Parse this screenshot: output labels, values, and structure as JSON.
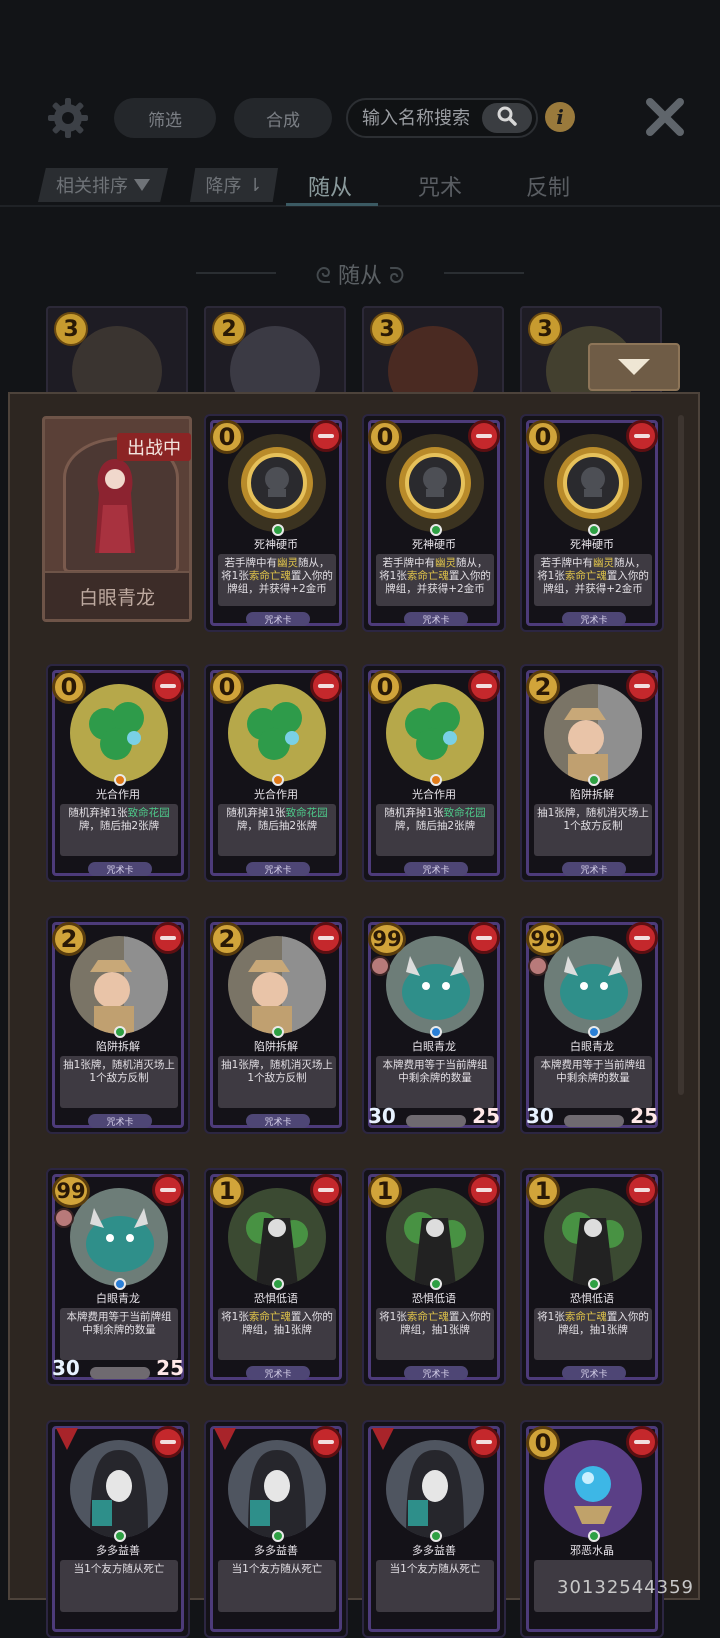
{
  "topbar": {
    "filter_label": "筛选",
    "craft_label": "合成",
    "search_placeholder": "输入名称搜索"
  },
  "sortbar": {
    "relevance_label": "相关排序",
    "order_label": "降序",
    "tabs": [
      "随从",
      "咒术",
      "反制"
    ],
    "active_tab": "随从"
  },
  "section": {
    "title": "随从"
  },
  "mini_cards": [
    {
      "cost": "3"
    },
    {
      "cost": "2"
    },
    {
      "cost": "3"
    },
    {
      "cost": "3"
    }
  ],
  "hero": {
    "badge": "出战中",
    "name": "白眼青龙"
  },
  "cards": [
    {
      "cost": "0",
      "name": "死神硬币",
      "desc": [
        "若手牌中有",
        "幽灵",
        "随从，将1张",
        "索命亡魂",
        "置入你的牌组，并获得+2金币"
      ],
      "type": "咒术卡",
      "gem": "#2ea043",
      "art": "coin"
    },
    {
      "cost": "0",
      "name": "死神硬币",
      "desc": [
        "若手牌中有",
        "幽灵",
        "随从，将1张",
        "索命亡魂",
        "置入你的牌组，并获得+2金币"
      ],
      "type": "咒术卡",
      "gem": "#2ea043",
      "art": "coin"
    },
    {
      "cost": "0",
      "name": "死神硬币",
      "desc": [
        "若手牌中有",
        "幽灵",
        "随从，将1张",
        "索命亡魂",
        "置入你的牌组，并获得+2金币"
      ],
      "type": "咒术卡",
      "gem": "#2ea043",
      "art": "coin"
    },
    {
      "cost": "0",
      "name": "光合作用",
      "desc": [
        "随机弃掉1张",
        "",
        "",
        "致命花园",
        "牌，随后抽2张牌"
      ],
      "type": "咒术卡",
      "gem": "#e07b1a",
      "art": "clover"
    },
    {
      "cost": "0",
      "name": "光合作用",
      "desc": [
        "随机弃掉1张",
        "",
        "",
        "致命花园",
        "牌，随后抽2张牌"
      ],
      "type": "咒术卡",
      "gem": "#e07b1a",
      "art": "clover"
    },
    {
      "cost": "0",
      "name": "光合作用",
      "desc": [
        "随机弃掉1张",
        "",
        "",
        "致命花园",
        "牌，随后抽2张牌"
      ],
      "type": "咒术卡",
      "gem": "#e07b1a",
      "art": "clover"
    },
    {
      "cost": "2",
      "name": "陷阱拆解",
      "desc": [
        "抽1张牌，随机消灭场上1个敌方反制",
        "",
        "",
        "",
        ""
      ],
      "type": "咒术卡",
      "gem": "#2ea043",
      "art": "detective"
    },
    {
      "cost": "2",
      "name": "陷阱拆解",
      "desc": [
        "抽1张牌，随机消灭场上1个敌方反制",
        "",
        "",
        "",
        ""
      ],
      "type": "咒术卡",
      "gem": "#2ea043",
      "art": "detective"
    },
    {
      "cost": "2",
      "name": "陷阱拆解",
      "desc": [
        "抽1张牌，随机消灭场上1个敌方反制",
        "",
        "",
        "",
        ""
      ],
      "type": "咒术卡",
      "gem": "#2ea043",
      "art": "detective"
    },
    {
      "cost": "99",
      "name": "白眼青龙",
      "desc": [
        "本牌费用等于当前牌组中剩余牌的数量",
        "",
        "",
        "",
        ""
      ],
      "atk": "30",
      "hp": "25",
      "gem": "#2a7fd6",
      "art": "dragon"
    },
    {
      "cost": "99",
      "name": "白眼青龙",
      "desc": [
        "本牌费用等于当前牌组中剩余牌的数量",
        "",
        "",
        "",
        ""
      ],
      "atk": "30",
      "hp": "25",
      "gem": "#2a7fd6",
      "art": "dragon"
    },
    {
      "cost": "99",
      "name": "白眼青龙",
      "desc": [
        "本牌费用等于当前牌组中剩余牌的数量",
        "",
        "",
        "",
        ""
      ],
      "atk": "30",
      "hp": "25",
      "gem": "#2a7fd6",
      "art": "dragon"
    },
    {
      "cost": "1",
      "name": "恐惧低语",
      "desc": [
        "将1张",
        "",
        "",
        "索命亡魂",
        "置入你的牌组，抽1张牌"
      ],
      "type": "咒术卡",
      "gem": "#2ea043",
      "art": "skeleton"
    },
    {
      "cost": "1",
      "name": "恐惧低语",
      "desc": [
        "将1张",
        "",
        "",
        "索命亡魂",
        "置入你的牌组，抽1张牌"
      ],
      "type": "咒术卡",
      "gem": "#2ea043",
      "art": "skeleton"
    },
    {
      "cost": "1",
      "name": "恐惧低语",
      "desc": [
        "将1张",
        "",
        "",
        "索命亡魂",
        "置入你的牌组，抽1张牌"
      ],
      "type": "咒术卡",
      "gem": "#2ea043",
      "art": "skeleton"
    },
    {
      "cost": "",
      "name": "多多益善",
      "desc": [
        "当1个友方随从死亡",
        "",
        "",
        "",
        ""
      ],
      "type": "",
      "gem": "#2ea043",
      "art": "hooded"
    },
    {
      "cost": "",
      "name": "多多益善",
      "desc": [
        "当1个友方随从死亡",
        "",
        "",
        "",
        ""
      ],
      "type": "",
      "gem": "#2ea043",
      "art": "hooded"
    },
    {
      "cost": "",
      "name": "多多益善",
      "desc": [
        "当1个友方随从死亡",
        "",
        "",
        "",
        ""
      ],
      "type": "",
      "gem": "#2ea043",
      "art": "hooded"
    },
    {
      "cost": "0",
      "name": "邪恶水晶",
      "desc": [
        "",
        "",
        "",
        "",
        ""
      ],
      "type": "",
      "gem": "#2ea043",
      "art": "crystal"
    }
  ],
  "footer": {
    "id": "30132544359"
  }
}
